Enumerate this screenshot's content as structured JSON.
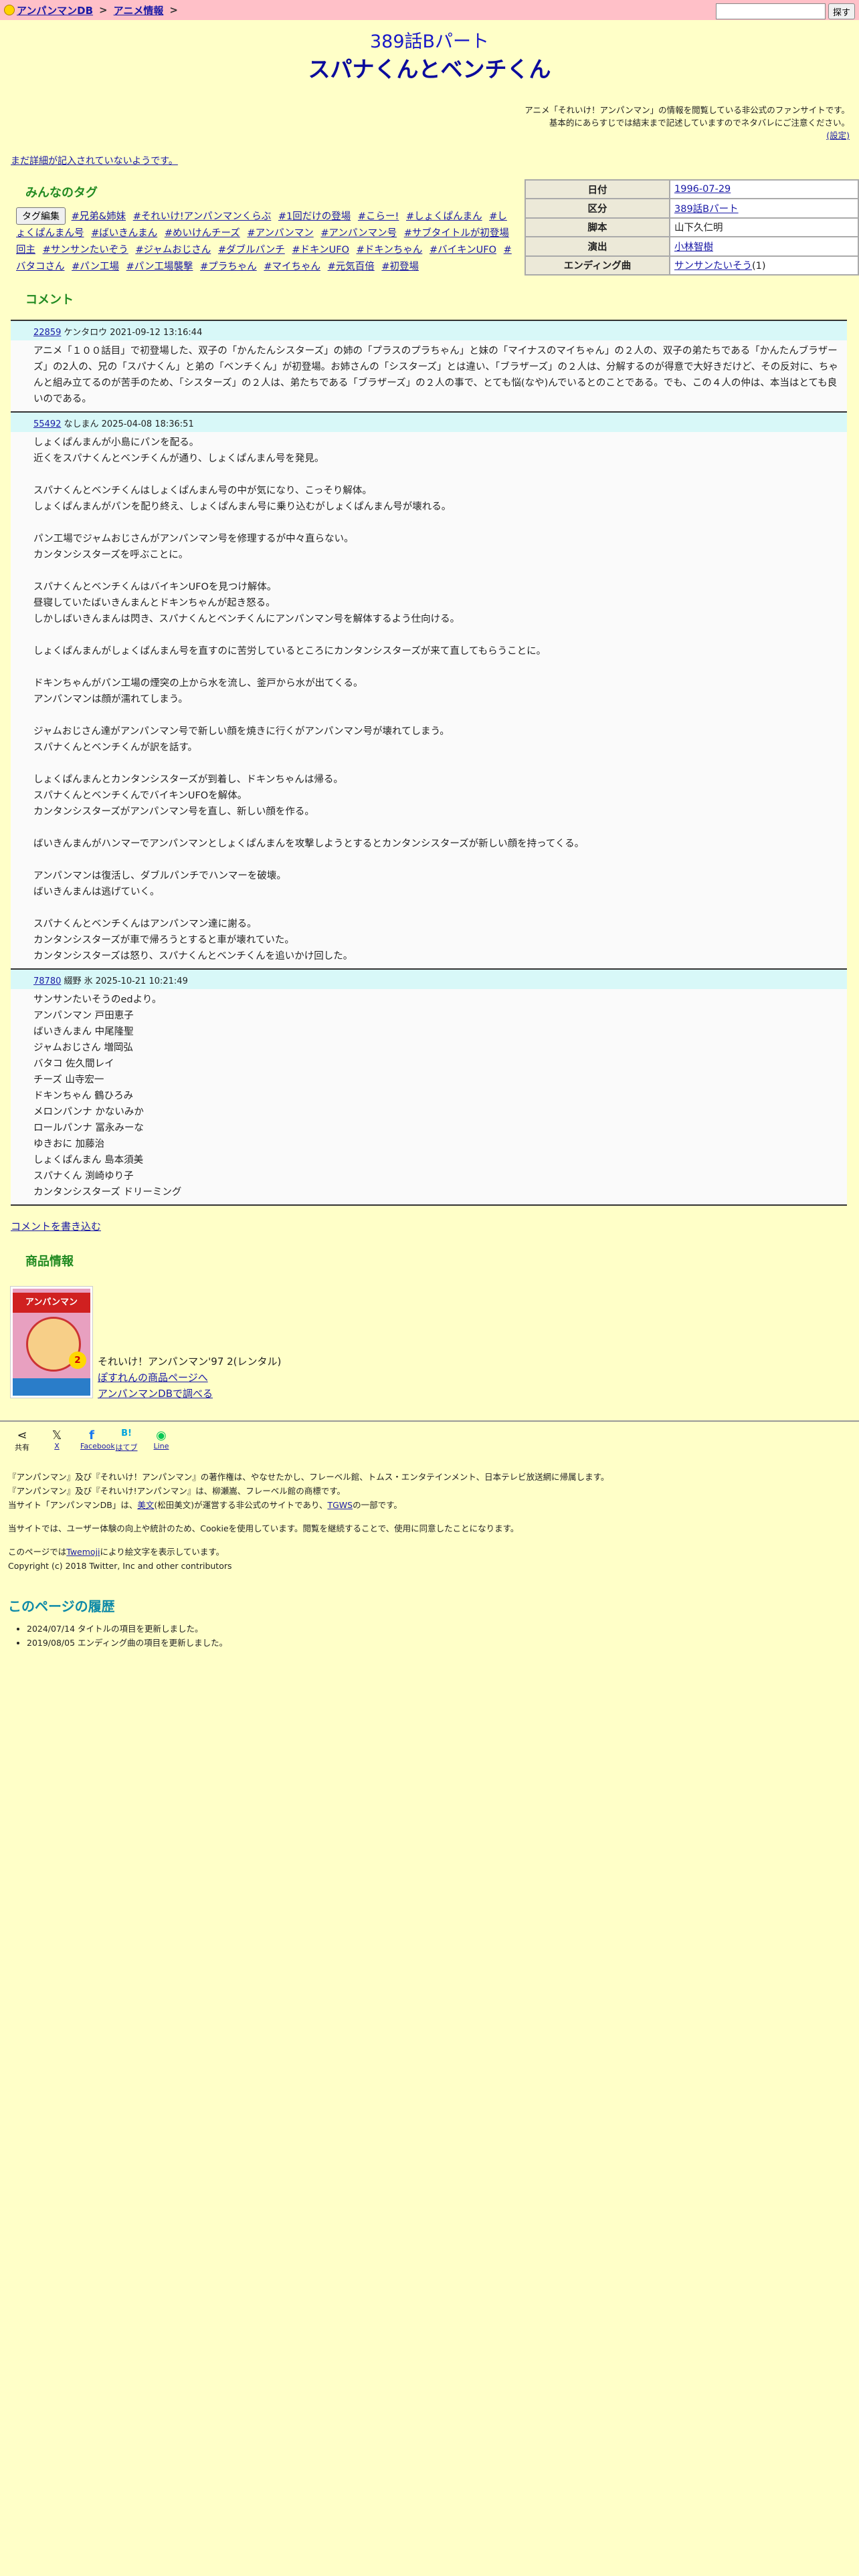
{
  "topbar": {
    "site_link": "アンパンマンDB",
    "sep1": ">",
    "anime_link": "アニメ情報",
    "sep2": ">",
    "search_placeholder": "",
    "search_button": "探す"
  },
  "header": {
    "subtitle": "389話Bパート",
    "title": "スパナくんとベンチくん"
  },
  "notice": {
    "line1": "アニメ「それいけ！アンパンマン」の情報を閲覧している非公式のファンサイトです。",
    "line2": "基本的にあらすじでは結末まで記述していますのでネタバレにご注意ください。",
    "settings_link": "(設定)"
  },
  "no_detail_link": "まだ詳細が記入されていないようです。",
  "tags_section": {
    "heading": "みんなのタグ",
    "edit_button": "タグ編集",
    "tags": [
      "#兄弟&姉妹",
      "#それいけ!アンパンマンくらぶ",
      "#1回だけの登場",
      "#こらー!",
      "#しょくぱんまん",
      "#しょくぱんまん号",
      "#ばいきんまん",
      "#めいけんチーズ",
      "#アンパンマン",
      "#アンパンマン号",
      "#サブタイトルが初登場回主",
      "#サンサンたいぞう",
      "#ジャムおじさん",
      "#ダブルパンチ",
      "#ドキンUFO",
      "#ドキンちゃん",
      "#バイキンUFO",
      "#バタコさん",
      "#パン工場",
      "#パン工場襲撃",
      "#プラちゃん",
      "#マイちゃん",
      "#元気百倍",
      "#初登場"
    ]
  },
  "info": [
    {
      "label": "日付",
      "value": "1996-07-29",
      "link": true
    },
    {
      "label": "区分",
      "value": "389話Bパート",
      "link": true
    },
    {
      "label": "脚本",
      "value": "山下久仁明",
      "link": false
    },
    {
      "label": "演出",
      "value": "小林智樹",
      "link": true
    },
    {
      "label": "エンディング曲",
      "value": "サンサンたいそう",
      "suffix": "(1)",
      "link": true
    }
  ],
  "comments_section": {
    "heading": "コメント",
    "comments": [
      {
        "id": "22859",
        "author": "ケンタロウ",
        "date": "2021-09-12 13:16:44",
        "lines": [
          "アニメ「１００話目」で初登場した、双子の「かんたんシスターズ」の姉の「プラスのプラちゃん」と妹の「マイナスのマイちゃん」の２人の、双子の弟たちである「かんたんブラザーズ」の2人の、兄の「スパナくん」と弟の「ベンチくん」が初登場。お姉さんの「シスターズ」とは違い、「ブラザーズ」の２人は、分解するのが得意で大好きだけど、その反対に、ちゃんと組み立てるのが苦手のため、「シスターズ」の２人は、弟たちである「ブラザーズ」の２人の事で、とても悩(なや)んでいるとのことである。でも、この４人の仲は、本当はとても良いのである。"
        ]
      },
      {
        "id": "55492",
        "author": "なしまん",
        "date": "2025-04-08 18:36:51",
        "lines": [
          "しょくぱんまんが小島にパンを配る。",
          "近くをスパナくんとベンチくんが通り、しょくぱんまん号を発見。",
          "",
          "スパナくんとベンチくんはしょくぱんまん号の中が気になり、こっそり解体。",
          "しょくぱんまんがパンを配り終え、しょくぱんまん号に乗り込むがしょくぱんまん号が壊れる。",
          "",
          "パン工場でジャムおじさんがアンパンマン号を修理するが中々直らない。",
          "カンタンシスターズを呼ぶことに。",
          "",
          "スパナくんとベンチくんはバイキンUFOを見つけ解体。",
          "昼寝していたばいきんまんとドキンちゃんが起き怒る。",
          "しかしばいきんまんは閃き、スパナくんとベンチくんにアンパンマン号を解体するよう仕向ける。",
          "",
          "しょくぱんまんがしょくぱんまん号を直すのに苦労しているところにカンタンシスターズが来て直してもらうことに。",
          "",
          "ドキンちゃんがパン工場の煙突の上から水を流し、釜戸から水が出てくる。",
          "アンパンマンは顔が濡れてしまう。",
          "",
          "ジャムおじさん達がアンパンマン号で新しい顔を焼きに行くがアンパンマン号が壊れてしまう。",
          "スパナくんとベンチくんが訳を話す。",
          "",
          "しょくぱんまんとカンタンシスターズが到着し、ドキンちゃんは帰る。",
          "スパナくんとベンチくんでバイキンUFOを解体。",
          "カンタンシスターズがアンパンマン号を直し、新しい顔を作る。",
          "",
          "ばいきんまんがハンマーでアンパンマンとしょくぱんまんを攻撃しようとするとカンタンシスターズが新しい顔を持ってくる。",
          "",
          "アンパンマンは復活し、ダブルパンチでハンマーを破壊。",
          "ばいきんまんは逃げていく。",
          "",
          "スパナくんとベンチくんはアンパンマン達に謝る。",
          "カンタンシスターズが車で帰ろうとすると車が壊れていた。",
          "カンタンシスターズは怒り、スパナくんとベンチくんを追いかけ回した。"
        ]
      },
      {
        "id": "78780",
        "author": "綴野 氷",
        "date": "2025-10-21 10:21:49",
        "lines": [
          "サンサンたいそうのedより。",
          "アンパンマン 戸田恵子",
          "ばいきんまん 中尾隆聖",
          "ジャムおじさん 増岡弘",
          "バタコ 佐久間レイ",
          "チーズ 山寺宏一",
          "ドキンちゃん 鶴ひろみ",
          "メロンパンナ かないみか",
          "ロールパンナ 冨永みーな",
          "ゆきおに 加藤治",
          "しょくぱんまん 島本須美",
          "スパナくん 渕崎ゆり子",
          "カンタンシスターズ ドリーミング"
        ]
      }
    ]
  },
  "write_comment_link": "コメントを書き込む",
  "products_section": {
    "heading": "商品情報",
    "cover_title": "アンパンマン",
    "cover_badge": "2",
    "name": "それいけ！アンパンマン'97 2(レンタル)",
    "link1": "ぽすれんの商品ページへ",
    "link2": "アンパンマンDBで調べる"
  },
  "share": [
    {
      "icon": "share-icon",
      "glyph": "⋖",
      "label": "共有",
      "link": false
    },
    {
      "icon": "x-icon",
      "glyph": "𝕏",
      "label": "X",
      "link": true
    },
    {
      "icon": "facebook-icon",
      "glyph": "f",
      "label": "Facebook",
      "link": true
    },
    {
      "icon": "hatena-icon",
      "glyph": "B!",
      "label": "はてブ",
      "link": true
    },
    {
      "icon": "line-icon",
      "glyph": "◉",
      "label": "Line",
      "link": true
    }
  ],
  "footer": {
    "copyright1": "『アンパンマン』及び『それいけ！アンパンマン』の著作権は、やなせたかし、フレーベル館、トムス・エンタテインメント、日本テレビ放送網に帰属します。",
    "copyright2": "『アンパンマン』及び『それいけ!アンパンマン』は、柳瀬嵩、フレーベル館の商標です。",
    "site_note_pre": "当サイト「アンパンマンDB」は、",
    "site_note_link1": "美文",
    "site_note_mid": "(松田美文)が運営する非公式のサイトであり、",
    "site_note_link2": "TGWS",
    "site_note_post": "の一部です。",
    "cookie": "当サイトでは、ユーザー体験の向上や統計のため、Cookieを使用しています。閲覧を継続することで、使用に同意したことになります。",
    "twemoji_pre": "このページでは",
    "twemoji_link": "Twemoji",
    "twemoji_post": "により絵文字を表示しています。",
    "twitter_copy": "Copyright (c) 2018 Twitter, Inc and other contributors"
  },
  "history_section": {
    "heading": "このページの履歴",
    "items": [
      "2024/07/14 タイトルの項目を更新しました。",
      "2019/08/05 エンディング曲の項目を更新しました。"
    ]
  }
}
